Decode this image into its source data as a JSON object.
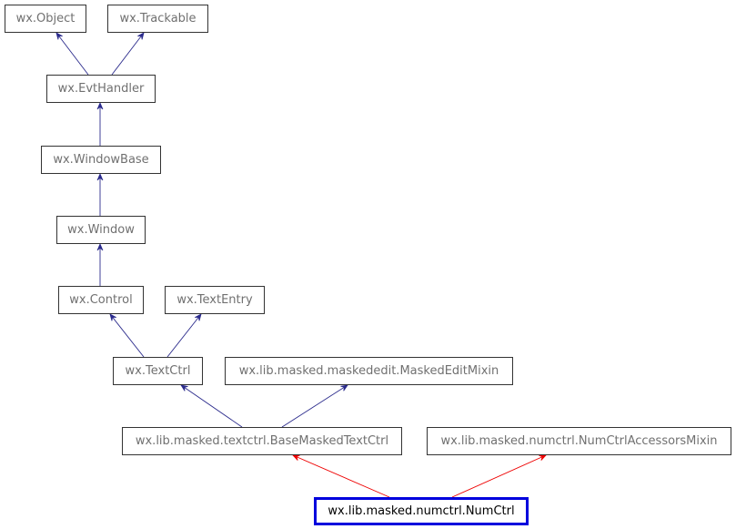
{
  "diagram": {
    "type": "class-inheritance",
    "nodes": [
      {
        "id": "object",
        "label": "wx.Object"
      },
      {
        "id": "trackable",
        "label": "wx.Trackable"
      },
      {
        "id": "evthandler",
        "label": "wx.EvtHandler"
      },
      {
        "id": "windowbase",
        "label": "wx.WindowBase"
      },
      {
        "id": "window",
        "label": "wx.Window"
      },
      {
        "id": "control",
        "label": "wx.Control"
      },
      {
        "id": "textentry",
        "label": "wx.TextEntry"
      },
      {
        "id": "textctrl",
        "label": "wx.TextCtrl"
      },
      {
        "id": "maskededitmixin",
        "label": "wx.lib.masked.maskededit.MaskedEditMixin"
      },
      {
        "id": "basemaskedtextctrl",
        "label": "wx.lib.masked.textctrl.BaseMaskedTextCtrl"
      },
      {
        "id": "numctrlaccessorsmixin",
        "label": "wx.lib.masked.numctrl.NumCtrlAccessorsMixin"
      },
      {
        "id": "numctrl",
        "label": "wx.lib.masked.numctrl.NumCtrl"
      }
    ],
    "edges": [
      {
        "from": "evthandler",
        "to": "object",
        "color": "#2b2b8c"
      },
      {
        "from": "evthandler",
        "to": "trackable",
        "color": "#2b2b8c"
      },
      {
        "from": "windowbase",
        "to": "evthandler",
        "color": "#2b2b8c"
      },
      {
        "from": "window",
        "to": "windowbase",
        "color": "#2b2b8c"
      },
      {
        "from": "control",
        "to": "window",
        "color": "#2b2b8c"
      },
      {
        "from": "textctrl",
        "to": "control",
        "color": "#2b2b8c"
      },
      {
        "from": "textctrl",
        "to": "textentry",
        "color": "#2b2b8c"
      },
      {
        "from": "basemaskedtextctrl",
        "to": "textctrl",
        "color": "#2b2b8c"
      },
      {
        "from": "basemaskedtextctrl",
        "to": "maskededitmixin",
        "color": "#2b2b8c"
      },
      {
        "from": "numctrl",
        "to": "basemaskedtextctrl",
        "color": "#ee0000"
      },
      {
        "from": "numctrl",
        "to": "numctrlaccessorsmixin",
        "color": "#ee0000"
      }
    ],
    "focus_node": "numctrl",
    "colors": {
      "focus_border": "#0000dd",
      "edge": "#2b2b8c",
      "focus_edge": "#ee0000",
      "node_text": "#707070"
    }
  }
}
